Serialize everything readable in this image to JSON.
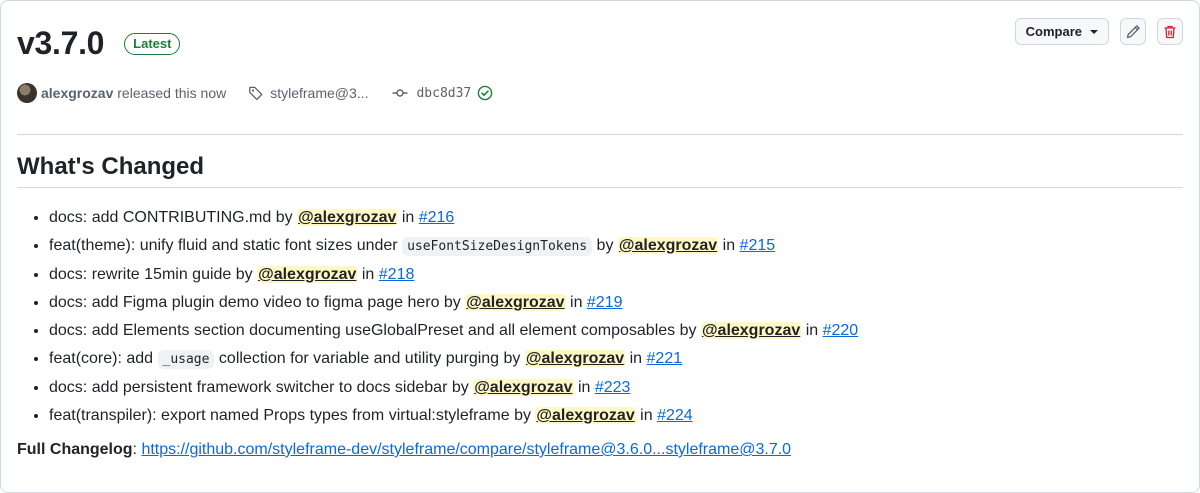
{
  "release": {
    "version": "v3.7.0",
    "badge": "Latest",
    "author": "alexgrozav",
    "released_text": "released this now",
    "tag": "styleframe@3...",
    "commit": "dbc8d37"
  },
  "actions": {
    "compare_label": "Compare",
    "edit_icon": "pencil-icon",
    "delete_icon": "trash-icon"
  },
  "section_title": "What's Changed",
  "changes": [
    {
      "before": "docs: add CONTRIBUTING.md by ",
      "mention": "@alexgrozav",
      "pr": "#216"
    },
    {
      "before": "feat(theme): unify fluid and static font sizes under ",
      "code": "useFontSizeDesignTokens",
      "after": " by ",
      "mention": "@alexgrozav",
      "pr": "#215"
    },
    {
      "before": "docs: rewrite 15min guide by ",
      "mention": "@alexgrozav",
      "pr": "#218"
    },
    {
      "before": "docs: add Figma plugin demo video to figma page hero by ",
      "mention": "@alexgrozav",
      "pr": "#219"
    },
    {
      "before": "docs: add Elements section documenting useGlobalPreset and all element composables by ",
      "mention": "@alexgrozav",
      "pr": "#220"
    },
    {
      "before": "feat(core): add ",
      "code": "_usage",
      "after": " collection for variable and utility purging by ",
      "mention": "@alexgrozav",
      "pr": "#221"
    },
    {
      "before": "docs: add persistent framework switcher to docs sidebar by ",
      "mention": "@alexgrozav",
      "pr": "#223"
    },
    {
      "before": "feat(transpiler): export named Props types from virtual:styleframe by ",
      "mention": "@alexgrozav",
      "pr": "#224"
    }
  ],
  "in_word": " in ",
  "full_changelog": {
    "label": "Full Changelog",
    "separator": ": ",
    "url": "https://github.com/styleframe-dev/styleframe/compare/styleframe@3.6.0...styleframe@3.7.0"
  },
  "colors": {
    "accent": "#0969da",
    "success": "#1a7f37",
    "danger": "#cf222e",
    "mention_bg": "#fff8c5"
  }
}
